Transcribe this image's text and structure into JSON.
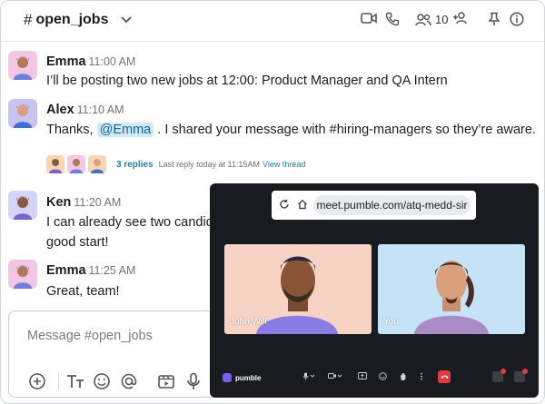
{
  "header": {
    "hash": "#",
    "channel_name": "open_jobs",
    "member_count": "10"
  },
  "messages": [
    {
      "author": "Emma",
      "time": "11:00 AM",
      "text": "I’ll be posting two new jobs at 12:00: Product Manager and QA Intern",
      "avatar_color": "#f3c6e3"
    },
    {
      "author": "Alex",
      "time": "11:10 AM",
      "text_before": "Thanks, ",
      "mention": "@Emma",
      "text_after": " . I shared your message with #hiring-managers so they’re aware.",
      "avatar_color": "#c9c3ef"
    },
    {
      "author": "Ken",
      "time": "11:20 AM",
      "line1": "I can already see two candida",
      "line2": "good start!",
      "avatar_color": "#d3d5f8"
    },
    {
      "author": "Emma",
      "time": "11:25 AM",
      "text": "Great, team!",
      "avatar_color": "#f3c6e3"
    }
  ],
  "thread": {
    "replies": "3 replies",
    "last_reply": "Last reply today at 11:15AM",
    "view_thread": "View thread"
  },
  "composer": {
    "placeholder": "Message #open_jobs"
  },
  "call": {
    "url": "meet.pumble.com/atq-medd-sir",
    "participants": [
      {
        "name": "John Will",
        "bg": "#f7d3c3"
      },
      {
        "name": "You",
        "bg": "#c5e3f7"
      }
    ],
    "brand": "pumble"
  },
  "colors": {
    "accent": "#1e7ec2",
    "mention_bg": "#cfe9f7",
    "call_bg": "#181b1f",
    "end_call": "#e5383b"
  }
}
